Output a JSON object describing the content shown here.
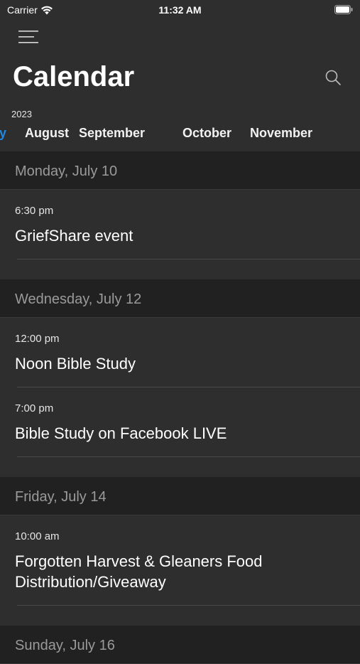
{
  "status_bar": {
    "carrier": "Carrier",
    "time": "11:32 AM"
  },
  "header": {
    "title": "Calendar",
    "year": "2023",
    "accent_color": "#1e88e5"
  },
  "months": [
    {
      "label": "July",
      "active": true
    },
    {
      "label": "August",
      "active": false
    },
    {
      "label": "September",
      "active": false
    },
    {
      "label": "October",
      "active": false
    },
    {
      "label": "November",
      "active": false
    }
  ],
  "days": [
    {
      "date": "Monday, July 10",
      "events": [
        {
          "time": "6:30 pm",
          "title": "GriefShare event"
        }
      ]
    },
    {
      "date": "Wednesday, July 12",
      "events": [
        {
          "time": "12:00 pm",
          "title": "Noon Bible Study"
        },
        {
          "time": "7:00 pm",
          "title": "Bible Study on Facebook LIVE"
        }
      ]
    },
    {
      "date": "Friday, July 14",
      "events": [
        {
          "time": "10:00 am",
          "title": "Forgotten Harvest & Gleaners Food Distribution/Giveaway"
        }
      ]
    },
    {
      "date": "Sunday, July 16",
      "events": []
    }
  ]
}
